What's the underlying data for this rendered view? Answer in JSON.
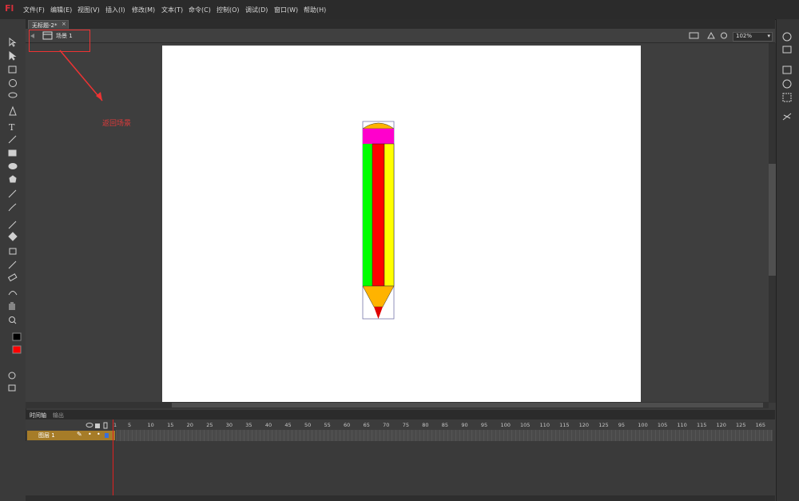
{
  "app": {
    "logo": "Fl"
  },
  "menu": [
    "文件(F)",
    "编辑(E)",
    "视图(V)",
    "插入(I)",
    "修改(M)",
    "文本(T)",
    "命令(C)",
    "控制(O)",
    "调试(D)",
    "窗口(W)",
    "帮助(H)"
  ],
  "document": {
    "tab_label": "无标题-2*",
    "close_glyph": "×"
  },
  "scene": {
    "label": "场景 1"
  },
  "zoom": {
    "value": "102%"
  },
  "annotation": {
    "text": "返回场景"
  },
  "timeline": {
    "tabs": [
      "时间轴",
      "输出"
    ],
    "layer_name": "图层 1",
    "frame_labels": [
      "1",
      "5",
      "10",
      "15",
      "20",
      "25",
      "30",
      "35",
      "40",
      "45",
      "50",
      "55",
      "60",
      "65",
      "70",
      "75",
      "80",
      "85",
      "90",
      "95",
      "100",
      "105",
      "110",
      "115",
      "120",
      "125",
      "95",
      "100",
      "105",
      "110",
      "115",
      "120",
      "125",
      "165"
    ]
  },
  "colors": {
    "stroke": "#000000",
    "fill": "#ff0000",
    "annotation": "#e23b3b",
    "pencil_orange": "#ffb300",
    "pencil_pink": "#ff00cc",
    "pencil_green": "#00ff00",
    "pencil_red": "#ff0000",
    "pencil_yellow": "#ffff00"
  },
  "icons": {
    "toolbar": [
      "selection-tool-icon",
      "subselection-tool-icon",
      "free-transform-icon",
      "3d-rotation-icon",
      "lasso-icon",
      "pen-icon",
      "text-tool-icon",
      "line-tool-icon",
      "rectangle-tool-icon",
      "oval-tool-icon",
      "polystar-icon",
      "pencil-tool-icon",
      "brush-tool-icon",
      "bone-tool-icon",
      "paint-bucket-icon",
      "ink-bottle-icon",
      "eyedropper-icon",
      "eraser-icon",
      "deco-tool-icon",
      "hand-tool-icon",
      "zoom-tool-icon"
    ]
  }
}
